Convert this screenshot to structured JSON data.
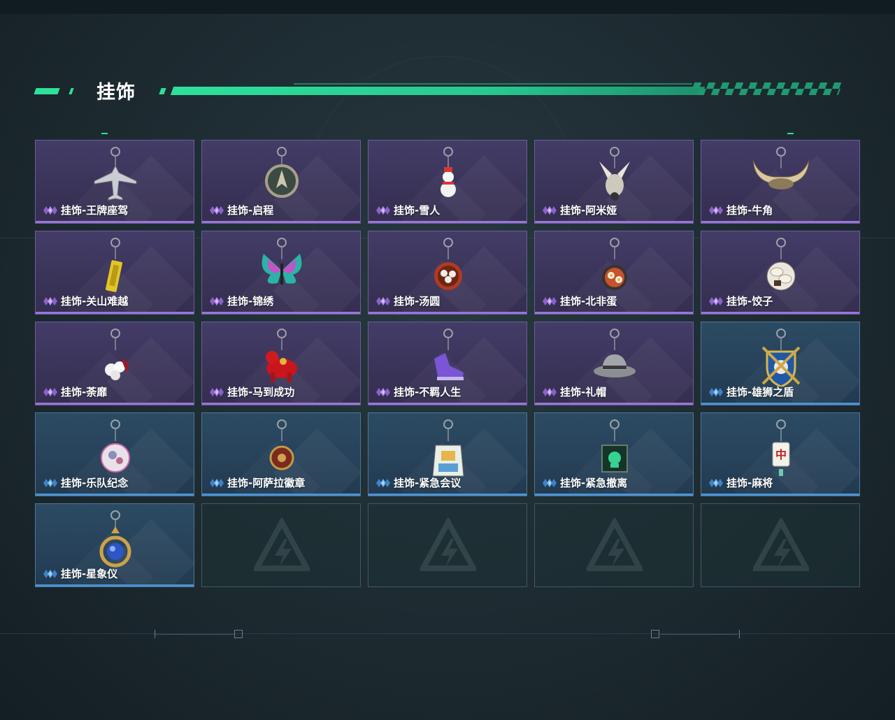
{
  "header": {
    "title": "挂饰"
  },
  "items": [
    {
      "label": "挂饰-王牌座驾",
      "rarity": "purple",
      "icon": "jet-plane-charm-icon"
    },
    {
      "label": "挂饰-启程",
      "rarity": "purple",
      "icon": "compass-medallion-charm-icon"
    },
    {
      "label": "挂饰-雪人",
      "rarity": "purple",
      "icon": "snowman-charm-icon"
    },
    {
      "label": "挂饰-阿米娅",
      "rarity": "purple",
      "icon": "bunny-plush-charm-icon"
    },
    {
      "label": "挂饰-牛角",
      "rarity": "purple",
      "icon": "bull-horns-charm-icon"
    },
    {
      "label": "挂饰-关山难越",
      "rarity": "purple",
      "icon": "gold-bar-charm-icon"
    },
    {
      "label": "挂饰-锦绣",
      "rarity": "purple",
      "icon": "butterfly-charm-icon"
    },
    {
      "label": "挂饰-汤圆",
      "rarity": "purple",
      "icon": "rice-ball-bowl-charm-icon"
    },
    {
      "label": "挂饰-北非蛋",
      "rarity": "purple",
      "icon": "shakshuka-pan-charm-icon"
    },
    {
      "label": "挂饰-饺子",
      "rarity": "purple",
      "icon": "dumpling-plate-charm-icon"
    },
    {
      "label": "挂饰-荼靡",
      "rarity": "purple",
      "icon": "flower-bouquet-charm-icon"
    },
    {
      "label": "挂饰-马到成功",
      "rarity": "purple",
      "icon": "red-horse-charm-icon"
    },
    {
      "label": "挂饰-不羁人生",
      "rarity": "purple",
      "icon": "sneaker-charm-icon"
    },
    {
      "label": "挂饰-礼帽",
      "rarity": "purple",
      "icon": "fedora-hat-charm-icon"
    },
    {
      "label": "挂饰-雄狮之盾",
      "rarity": "blue",
      "icon": "lion-shield-charm-icon"
    },
    {
      "label": "挂饰-乐队纪念",
      "rarity": "blue",
      "icon": "band-badge-charm-icon"
    },
    {
      "label": "挂饰-阿萨拉徽章",
      "rarity": "blue",
      "icon": "asala-emblem-charm-icon"
    },
    {
      "label": "挂饰-紧急会议",
      "rarity": "blue",
      "icon": "meeting-acrylic-charm-icon"
    },
    {
      "label": "挂饰-紧急撤离",
      "rarity": "blue",
      "icon": "evacuation-cube-charm-icon"
    },
    {
      "label": "挂饰-麻将",
      "rarity": "blue",
      "icon": "mahjong-tile-charm-icon"
    },
    {
      "label": "挂饰-星象仪",
      "rarity": "blue",
      "icon": "astrolabe-charm-icon"
    }
  ],
  "empty_slots": 4,
  "mahjong_glyph": "中",
  "colors": {
    "accent_green": "#2ee09a",
    "purple_rarity": "#9a74d8",
    "blue_rarity": "#4a92d4"
  }
}
